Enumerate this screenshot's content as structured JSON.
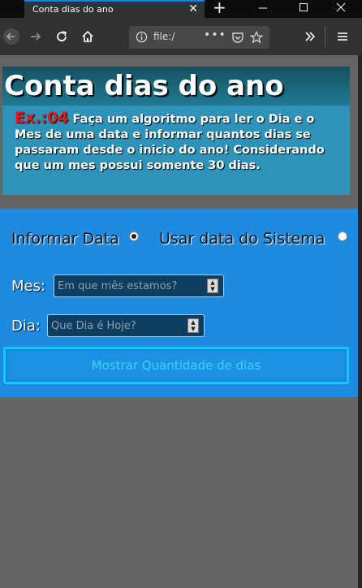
{
  "browser": {
    "tab_title": "Conta dias do ano",
    "url_text": "file:/",
    "new_tab_glyph": "+",
    "close_glyph": "✕"
  },
  "page": {
    "title": "Conta dias do ano",
    "exercise_label": "Ex.:04",
    "description": " Faça um algoritmo para ler o Dia e o Mes de uma data e informar quantos dias se passaram desde o inicio do ano! Considerando que um mes possui somente 30 dias."
  },
  "form": {
    "radio_manual_label": "Informar Data",
    "radio_system_label": "Usar data do Sistema",
    "month_label": "Mes:",
    "month_placeholder": "Em que mês estamos?",
    "day_label": "Dia:",
    "day_placeholder": "Que Dia é Hoje?",
    "submit_label": "Mostrar Quantidade de dias"
  },
  "colors": {
    "accent_tab": "#0a84ff",
    "header_bg": "#2f92b8",
    "form_bg": "#1e8ae0",
    "exercise_red": "#e41b1b"
  }
}
